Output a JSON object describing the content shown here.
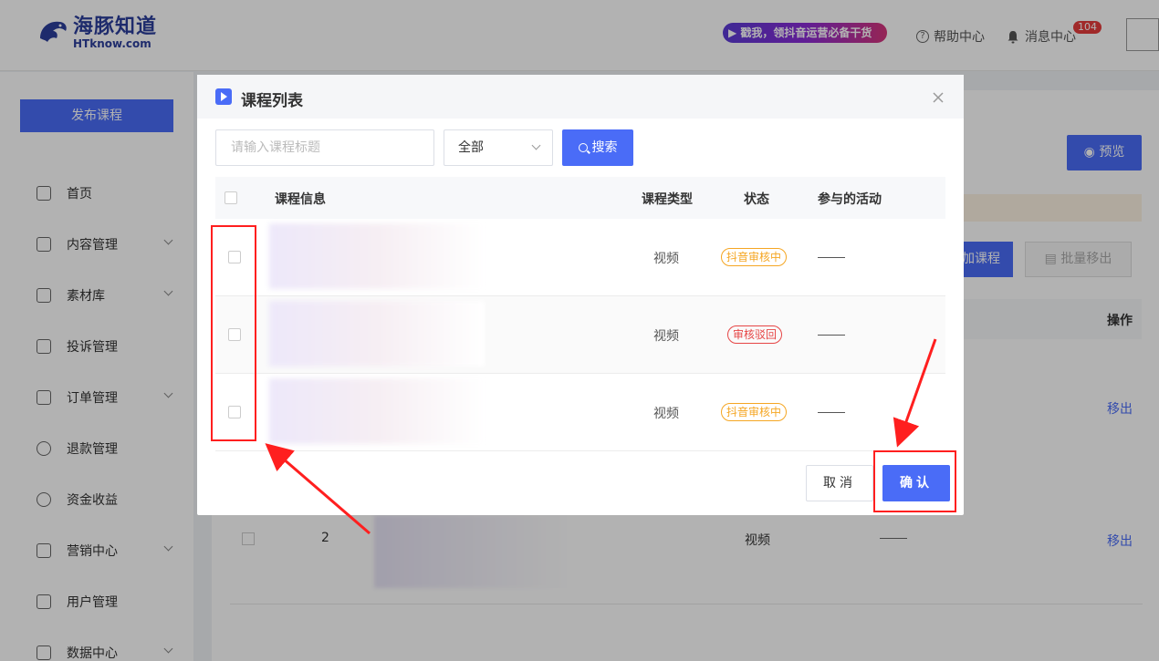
{
  "header": {
    "logo_cn": "海豚知道",
    "logo_en": "HTknow.com",
    "promo": "▶ 戳我，领抖音运营必备干货",
    "help": "帮助中心",
    "messages": "消息中心",
    "message_badge": "104"
  },
  "sidebar": {
    "publish": "发布课程",
    "items": [
      {
        "label": "首页",
        "icon": "home-icon"
      },
      {
        "label": "内容管理",
        "icon": "content-icon"
      },
      {
        "label": "素材库",
        "icon": "folder-icon"
      },
      {
        "label": "投诉管理",
        "icon": "complaint-icon"
      },
      {
        "label": "订单管理",
        "icon": "order-icon"
      },
      {
        "label": "退款管理",
        "icon": "refund-icon"
      },
      {
        "label": "资金收益",
        "icon": "income-icon"
      },
      {
        "label": "营销中心",
        "icon": "marketing-icon"
      },
      {
        "label": "用户管理",
        "icon": "user-icon"
      },
      {
        "label": "数据中心",
        "icon": "data-icon"
      }
    ]
  },
  "main": {
    "preview": "预览",
    "add_course": "加课程",
    "batch_remove": "批量移出",
    "op_header": "操作",
    "remove": "移出",
    "row_index": "2",
    "row_type": "视频",
    "row_activity": "——"
  },
  "modal": {
    "title": "课程列表",
    "search_placeholder": "请输入课程标题",
    "filter_value": "全部",
    "search_button": "搜索",
    "columns": [
      "课程信息",
      "课程类型",
      "状态",
      "参与的活动"
    ],
    "rows": [
      {
        "type": "视频",
        "status": "抖音审核中",
        "status_color": "orange",
        "activity": "——"
      },
      {
        "type": "视频",
        "status": "审核驳回",
        "status_color": "red",
        "activity": "——"
      },
      {
        "type": "视频",
        "status": "抖音审核中",
        "status_color": "orange",
        "activity": "——"
      }
    ],
    "cancel": "取消",
    "confirm": "确认"
  },
  "colors": {
    "primary": "#4a6cf7",
    "warning": "#f5a623",
    "danger": "#e64545",
    "annotation": "#ff1f1f"
  }
}
